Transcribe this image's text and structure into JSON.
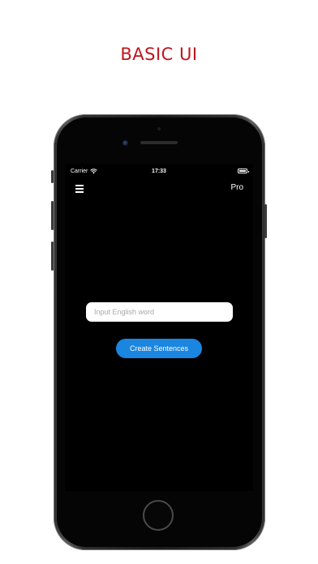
{
  "promo": {
    "title": "BASIC UI"
  },
  "status_bar": {
    "carrier": "Carrier",
    "time": "17:33",
    "battery_level": 1.0
  },
  "nav": {
    "menu_icon": "hamburger-menu-icon",
    "pro_label": "Pro"
  },
  "main": {
    "input": {
      "placeholder": "Input English word",
      "value": ""
    },
    "create_button_label": "Create Sentences"
  },
  "colors": {
    "promo_title": "#c0141c",
    "screen_background": "#000000",
    "primary_button": "#1a86e0",
    "input_background": "#ffffff"
  }
}
